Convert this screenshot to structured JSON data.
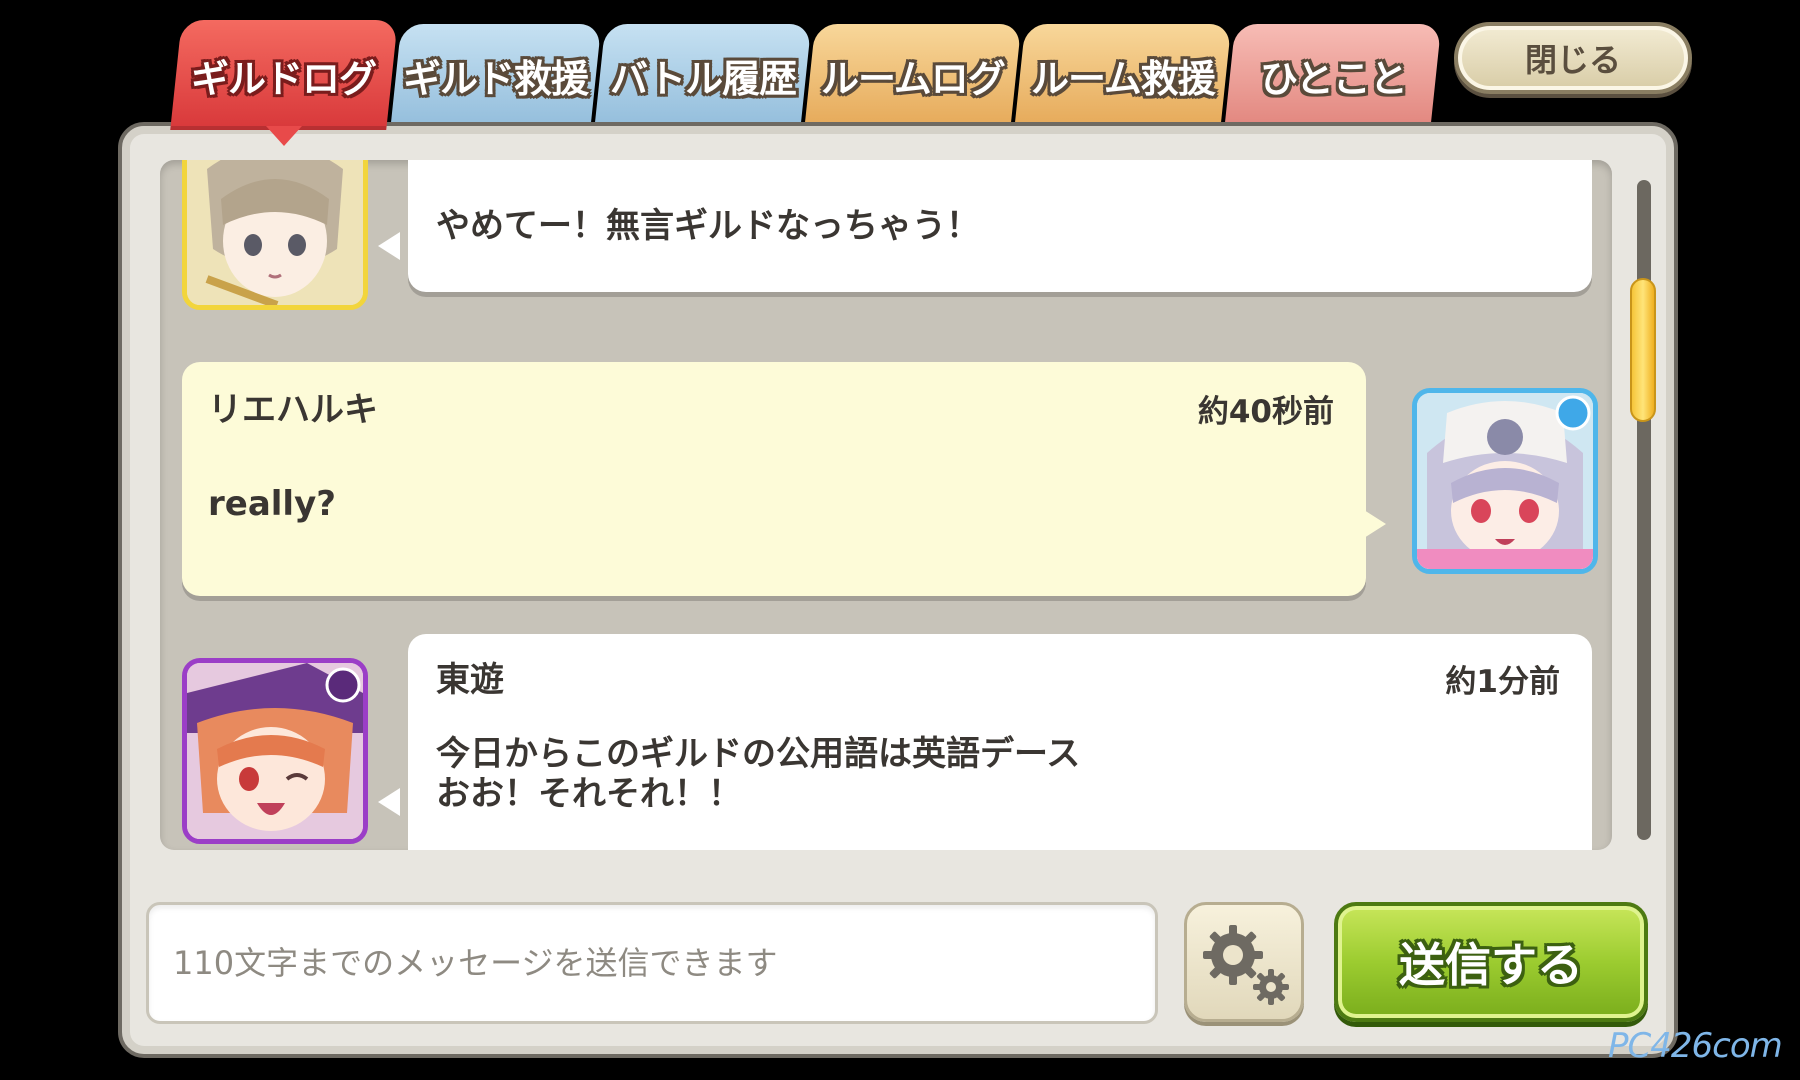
{
  "tabs": [
    {
      "label": "ギルドログ",
      "color": "#e84a4a",
      "active": true
    },
    {
      "label": "ギルド救援",
      "color": "#a9cde6",
      "active": false
    },
    {
      "label": "バトル履歴",
      "color": "#a9cde6",
      "active": false
    },
    {
      "label": "ルームログ",
      "color": "#f0c27a",
      "active": false
    },
    {
      "label": "ルーム救援",
      "color": "#f0c27a",
      "active": false
    },
    {
      "label": "ひとこと",
      "color": "#f2a6a0",
      "active": false
    }
  ],
  "close_label": "閉じる",
  "messages": [
    {
      "name": "",
      "time": "",
      "text": "やめてー！無言ギルドなっちゃう！",
      "side": "left",
      "avatar": "blonde-girl-avatar",
      "avatar_border": "#f2d53c"
    },
    {
      "name": "リエハルキ",
      "time": "約40秒前",
      "text": "really?",
      "side": "right",
      "avatar": "white-hair-girl-avatar",
      "avatar_border": "#4fb6ea"
    },
    {
      "name": "東遊",
      "time": "約1分前",
      "text": "今日からこのギルドの公用語は英語デース\nおお！それそれ！！",
      "side": "left",
      "avatar": "redhead-girl-avatar",
      "avatar_border": "#9b3ec7"
    }
  ],
  "input": {
    "placeholder": "110文字までのメッセージを送信できます",
    "value": ""
  },
  "send_label": "送信する",
  "settings_icon": "gear-icon",
  "watermark": "PC426com"
}
